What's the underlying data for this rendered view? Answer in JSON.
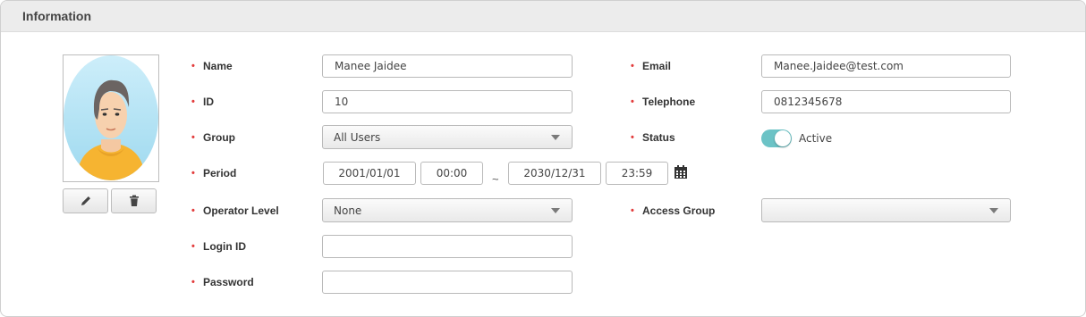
{
  "panel": {
    "title": "Information"
  },
  "photo": {
    "edit_icon": "pencil-icon",
    "delete_icon": "trash-icon"
  },
  "fields": {
    "name": {
      "label": "Name",
      "value": "Manee Jaidee"
    },
    "email": {
      "label": "Email",
      "value": "Manee.Jaidee@test.com"
    },
    "id": {
      "label": "ID",
      "value": "10"
    },
    "telephone": {
      "label": "Telephone",
      "value": "0812345678"
    },
    "group": {
      "label": "Group",
      "selected": "All Users"
    },
    "status": {
      "label": "Status",
      "value": "Active",
      "on": true
    },
    "period": {
      "label": "Period",
      "start_date": "2001/01/01",
      "start_time": "00:00",
      "separator": "~",
      "end_date": "2030/12/31",
      "end_time": "23:59",
      "calendar_icon": "calendar-icon"
    },
    "operator_level": {
      "label": "Operator Level",
      "selected": "None"
    },
    "access_group": {
      "label": "Access Group",
      "selected": ""
    },
    "login_id": {
      "label": "Login ID",
      "value": ""
    },
    "password": {
      "label": "Password",
      "value": ""
    }
  },
  "required_marker": "•",
  "colors": {
    "required": "#e23c3c",
    "toggle_on": "#6cc3c6"
  }
}
